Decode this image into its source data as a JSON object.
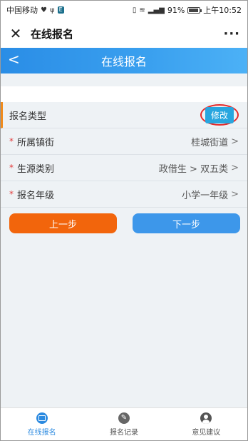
{
  "status_bar": {
    "carrier": "中国移动",
    "battery_percent": "91%",
    "battery_level": 0.91,
    "time": "上午10:52",
    "signal_label": "4G"
  },
  "app_bar": {
    "title": "在线报名",
    "close_icon": "close-icon",
    "more_icon": "more-icon"
  },
  "page_header": {
    "title": "在线报名",
    "back_icon": "chevron-left-icon"
  },
  "form": {
    "type_row": {
      "label": "报名类型",
      "edit_label": "修改"
    },
    "rows": [
      {
        "required": "*",
        "label": "所属镇街",
        "value": "桂城街道"
      },
      {
        "required": "*",
        "label": "生源类别",
        "value": "政借生 > 双五类"
      },
      {
        "required": "*",
        "label": "报名年级",
        "value": "小学一年级"
      }
    ],
    "chevron": ">"
  },
  "buttons": {
    "prev": "上一步",
    "next": "下一步"
  },
  "tabs": [
    {
      "label": "在线报名",
      "icon": "monitor-icon",
      "active": true
    },
    {
      "label": "报名记录",
      "icon": "pen-icon",
      "active": false
    },
    {
      "label": "意见建议",
      "icon": "user-icon",
      "active": false
    }
  ],
  "colors": {
    "header_blue": "#3aa0ef",
    "prev_orange": "#f2650c",
    "next_blue": "#3d97ea",
    "edit_blue": "#28a6df",
    "highlight_red": "#e62a2a",
    "accent_orange": "#f08b1c"
  }
}
